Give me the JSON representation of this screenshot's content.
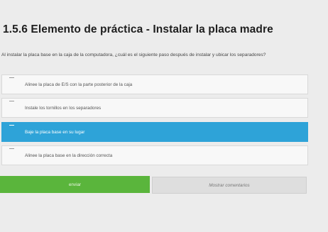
{
  "title": "1.5.6 Elemento de práctica - Instalar la placa madre",
  "question": "Al instalar la placa base en la caja de la computadora, ¿cuál es el siguiente paso después de instalar y ubicar los separadores?",
  "options": [
    {
      "label": "Alinee la placa de E/S con la parte posterior de la caja",
      "selected": false
    },
    {
      "label": "Instale los tornillos en los separadores",
      "selected": false
    },
    {
      "label": "Baje la placa base en su lugar",
      "selected": true
    },
    {
      "label": "Alinee la placa base en la dirección correcta",
      "selected": false
    }
  ],
  "buttons": {
    "submit": "enviar",
    "show_comments": "Mostrar comentarios"
  },
  "colors": {
    "selected": "#2ea3d8",
    "submit": "#5ab53c",
    "background": "#ececec"
  }
}
